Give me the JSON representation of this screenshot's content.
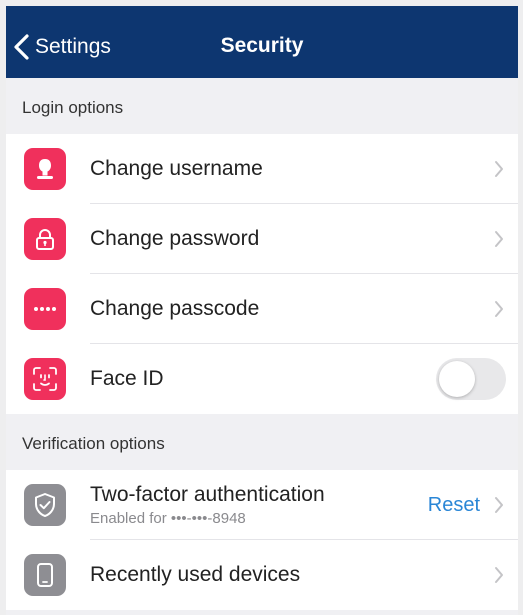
{
  "navbar": {
    "back_label": "Settings",
    "title": "Security",
    "color": "#0d3670"
  },
  "sections": {
    "login": {
      "header": "Login options",
      "items": [
        {
          "label": "Change username",
          "icon": "user-icon"
        },
        {
          "label": "Change password",
          "icon": "lock-icon"
        },
        {
          "label": "Change passcode",
          "icon": "passcode-dots-icon"
        },
        {
          "label": "Face ID",
          "icon": "face-id-icon",
          "toggle": false
        }
      ]
    },
    "verification": {
      "header": "Verification options",
      "items": [
        {
          "label": "Two-factor authentication",
          "sublabel": "Enabled for •••-•••-8948",
          "action": "Reset",
          "icon": "shield-check-icon"
        },
        {
          "label": "Recently used devices",
          "icon": "phone-icon"
        }
      ]
    }
  },
  "colors": {
    "accent_red": "#f0305c",
    "link_blue": "#2a86d6",
    "icon_gray": "#8e8e93"
  }
}
